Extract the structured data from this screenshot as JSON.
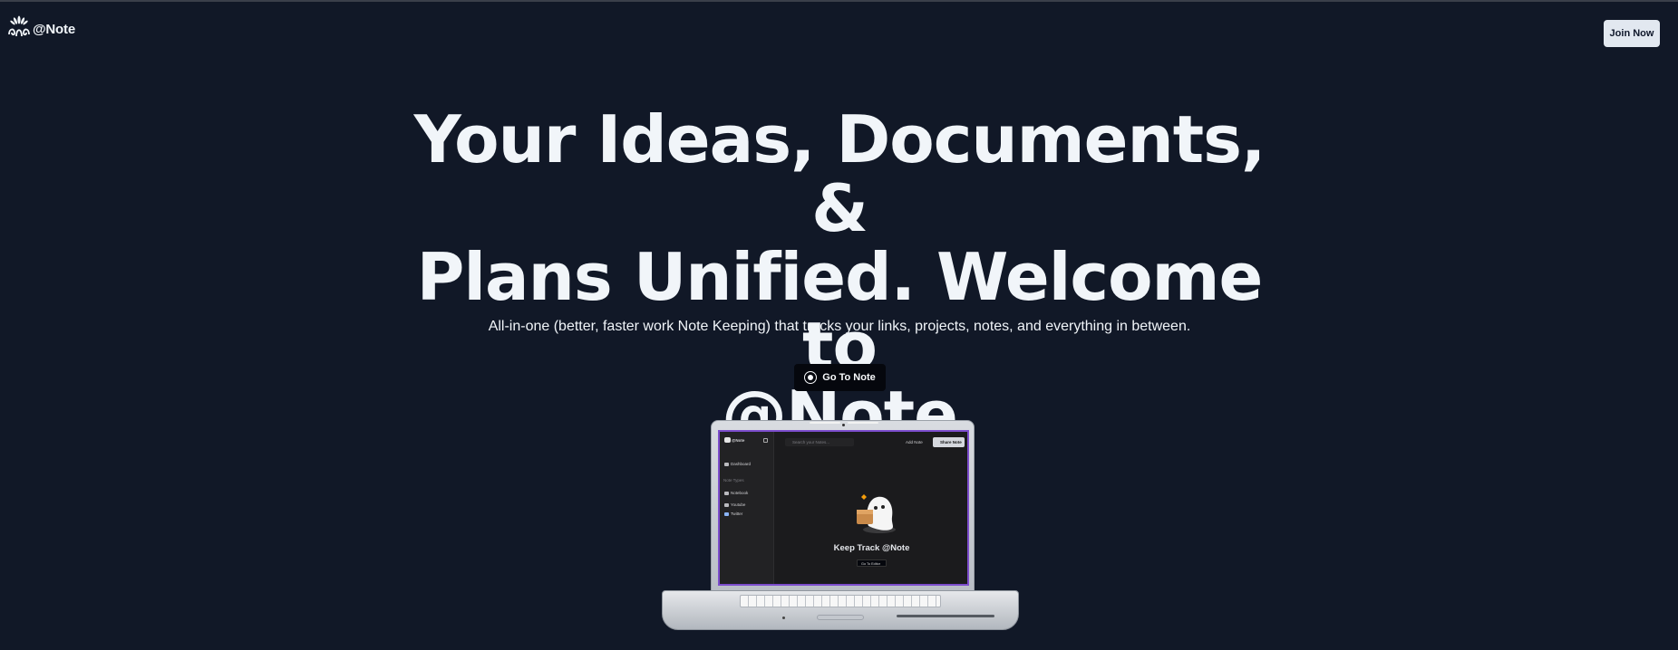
{
  "header": {
    "logo_text": "@Note",
    "join_label": "Join Now"
  },
  "hero": {
    "title_line1": "Your Ideas, Documents, &",
    "title_line2": "Plans Unified. Welcome to",
    "title_brand": "@Note",
    "subtitle": "All-in-one (better, faster work Note Keeping) that tracks your links, projects, notes, and everything in between.",
    "cta_label": "Go To Note"
  },
  "mockup": {
    "app_name": "@Note",
    "search_placeholder": "Search your Notes...",
    "add_label": "Add Note",
    "share_label": "Share Note",
    "nav_dashboard": "Dashboard",
    "nav_section": "Note Types",
    "nav_notebook": "Notebook",
    "nav_youtube": "Youtube",
    "nav_twitter": "Twitter",
    "heading": "Keep Track @Note",
    "cta_label": "Go To Editor"
  },
  "colors": {
    "background": "#111827",
    "text": "#f1f5f9",
    "join_button_bg": "#e2e8f0",
    "cta_bg": "#05070d",
    "screen_border": "#7c4dcc"
  },
  "icons": {
    "logo": "octopus-lotus-logo-icon",
    "cta": "radio-circle-icon"
  }
}
